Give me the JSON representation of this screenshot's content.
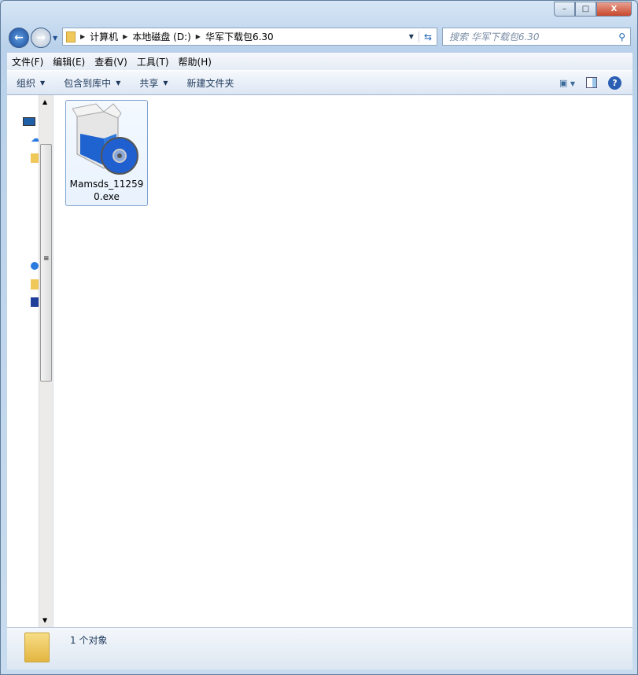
{
  "window": {
    "min": "–",
    "max": "□",
    "close": "X"
  },
  "address": {
    "segments": [
      "计算机",
      "本地磁盘 (D:)",
      "华军下载包6.30"
    ]
  },
  "search": {
    "placeholder": "搜索 华军下载包6.30"
  },
  "menu": [
    "文件(F)",
    "编辑(E)",
    "查看(V)",
    "工具(T)",
    "帮助(H)"
  ],
  "toolbar": {
    "organize": "组织",
    "include": "包含到库中",
    "share": "共享",
    "new_folder": "新建文件夹"
  },
  "files": [
    {
      "name_line1": "Mamsds_11259",
      "name_line2": "0.exe",
      "icon": "installer-box-cd-icon"
    }
  ],
  "status": {
    "text": "1 个对象"
  }
}
